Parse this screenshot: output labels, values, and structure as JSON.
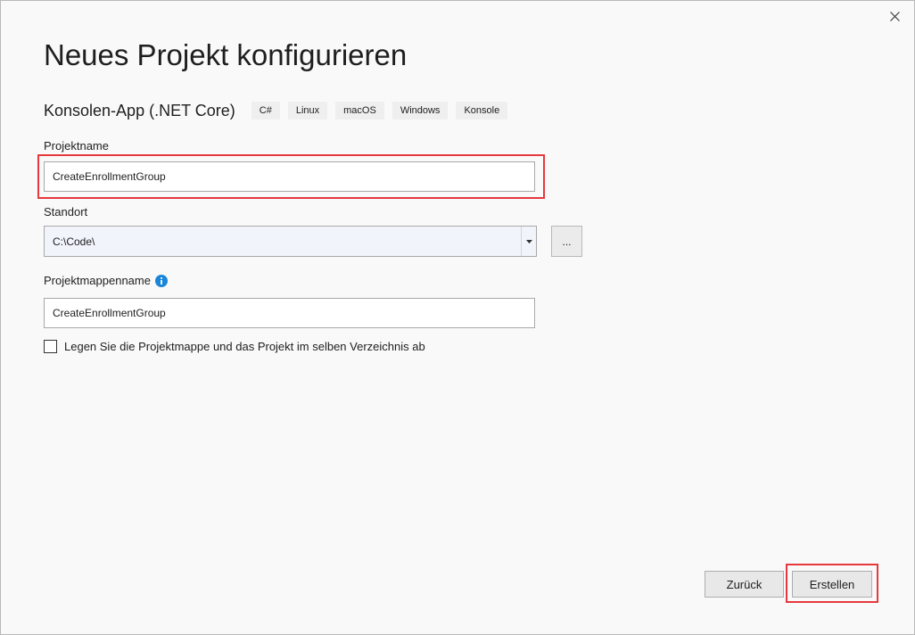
{
  "dialog": {
    "title": "Neues Projekt konfigurieren",
    "template_name": "Konsolen-App (.NET Core)",
    "tags": [
      "C#",
      "Linux",
      "macOS",
      "Windows",
      "Konsole"
    ]
  },
  "fields": {
    "project_name": {
      "label": "Projektname",
      "value": "CreateEnrollmentGroup"
    },
    "location": {
      "label": "Standort",
      "value": "C:\\Code\\",
      "browse_label": "..."
    },
    "solution_name": {
      "label": "Projektmappenname",
      "value": "CreateEnrollmentGroup"
    },
    "same_directory": {
      "label": "Legen Sie die Projektmappe und das Projekt im selben Verzeichnis ab",
      "checked": false
    }
  },
  "footer": {
    "back_label": "Zurück",
    "create_label": "Erstellen"
  },
  "colors": {
    "highlight": "#e5393e",
    "info_icon": "#1a86d9"
  },
  "icons": {
    "close": "close-icon",
    "dropdown": "chevron-down-icon",
    "info": "info-icon"
  }
}
